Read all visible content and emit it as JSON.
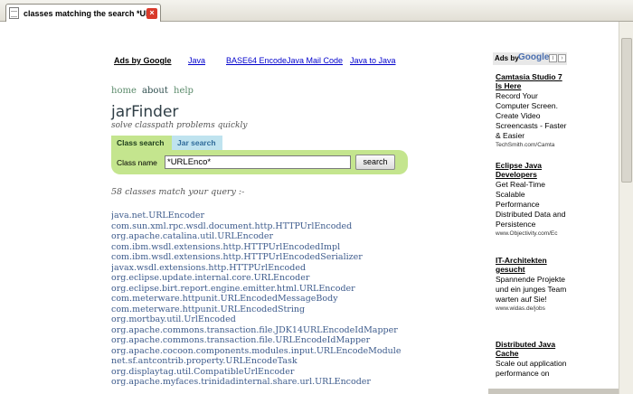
{
  "browser": {
    "tab_title": "classes matching the search *UR..."
  },
  "ads_bar": {
    "label": "Ads by Google",
    "links": [
      "Java",
      "BASE64 Encode",
      "Java Mail Code",
      "Java to Java"
    ]
  },
  "nav": {
    "home": "home",
    "about": "about",
    "help": "help"
  },
  "site": {
    "title": "jarFinder",
    "tagline": "solve classpath problems quickly"
  },
  "search": {
    "tab_class": "Class search",
    "tab_jar": "Jar search",
    "label": "Class name",
    "value": "*URLEnco*",
    "button": "search"
  },
  "results_summary": "58 classes match your query :-",
  "results": [
    "java.net.URLEncoder",
    "com.sun.xml.rpc.wsdl.document.http.HTTPUrlEncoded",
    "org.apache.catalina.util.URLEncoder",
    "com.ibm.wsdl.extensions.http.HTTPUrlEncodedImpl",
    "com.ibm.wsdl.extensions.http.HTTPUrlEncodedSerializer",
    "javax.wsdl.extensions.http.HTTPUrlEncoded",
    "org.eclipse.update.internal.core.URLEncoder",
    "org.eclipse.birt.report.engine.emitter.html.URLEncoder",
    "com.meterware.httpunit.URLEncodedMessageBody",
    "com.meterware.httpunit.URLEncodedString",
    "org.mortbay.util.UrlEncoded",
    "org.apache.commons.transaction.file.JDK14URLEncodeIdMapper",
    "org.apache.commons.transaction.file.URLEncodeIdMapper",
    "org.apache.cocoon.components.modules.input.URLEncodeModule",
    "net.sf.antcontrib.property.URLEncodeTask",
    "org.displaytag.util.CompatibleUrlEncoder",
    "org.apache.myfaces.trinidadinternal.share.url.URLEncoder"
  ],
  "side_ads": {
    "header_label": "Ads by",
    "header_brand": "Google",
    "items": [
      {
        "title": "Camtasia Studio 7 Is Here",
        "body": "Record Your Computer Screen. Create Video Screencasts - Faster & Easier",
        "url": "TechSmith.com/Camta"
      },
      {
        "title": "Eclipse Java Developers",
        "body": "Get Real-Time Scalable Performance Distributed Data and Persistence",
        "url": "www.Objectivity.com/Ec"
      },
      {
        "title": "IT-Architekten gesucht",
        "body": "Spannende Projekte und ein junges Team warten auf Sie!",
        "url": "www.widas.de/jobs"
      },
      {
        "title": "Distributed Java Cache",
        "body": "Scale out application performance on",
        "url": ""
      }
    ]
  }
}
